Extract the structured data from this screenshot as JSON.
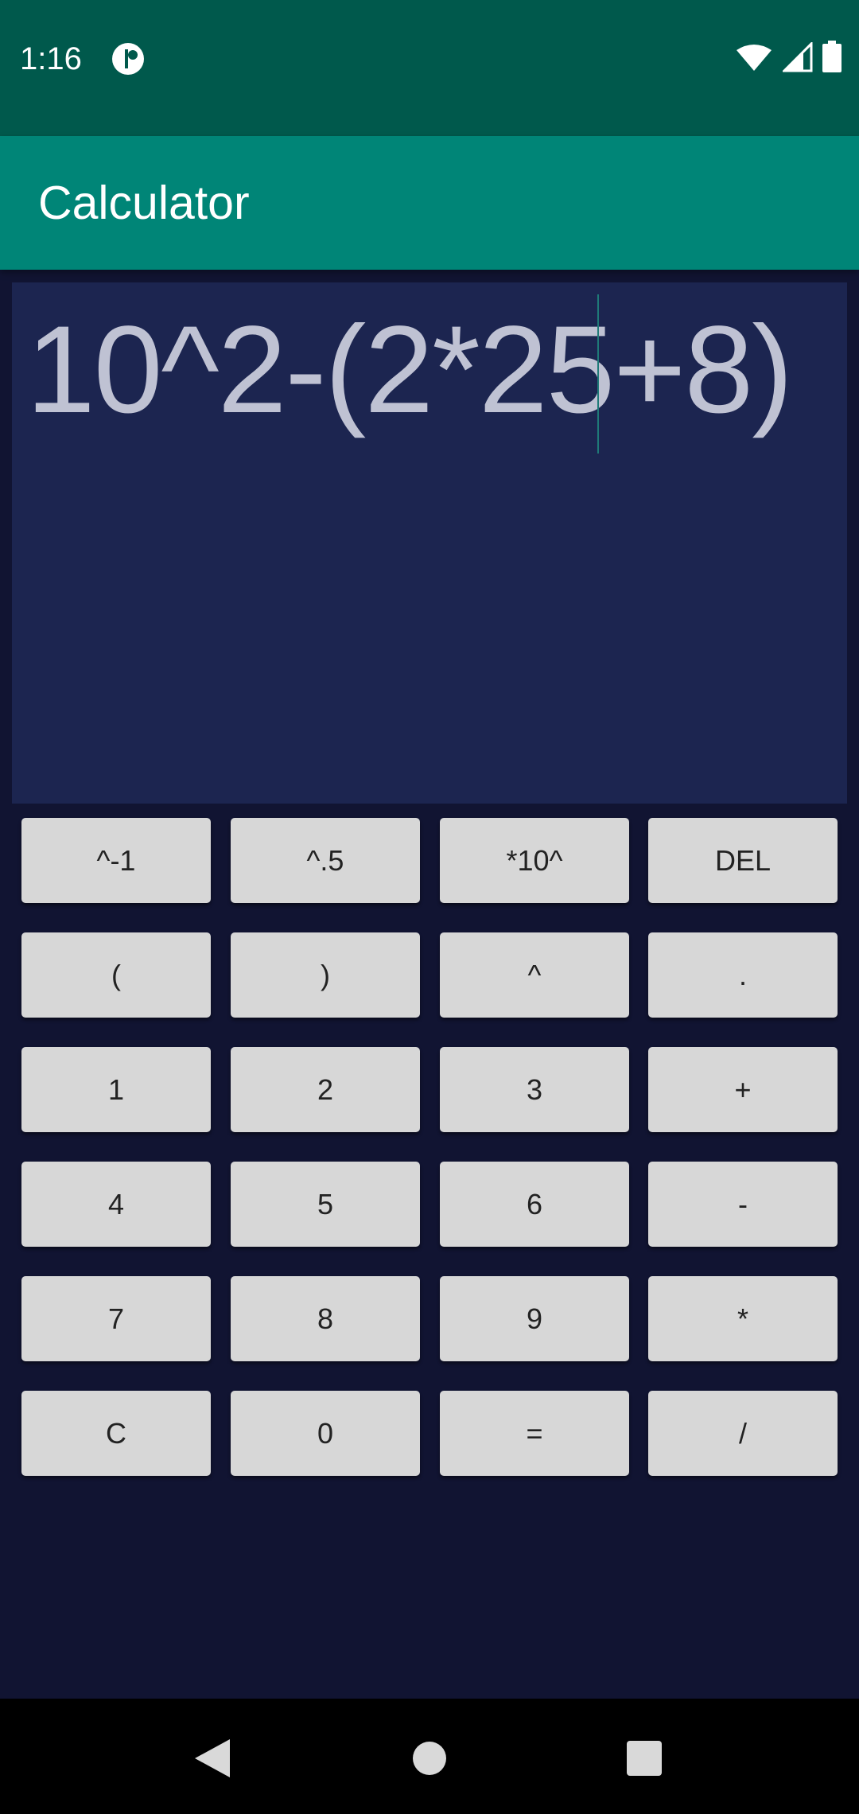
{
  "status_bar": {
    "time": "1:16",
    "left_icon": "media-player-icon",
    "right_icons": [
      "wifi-icon",
      "cellular-signal-icon",
      "battery-icon"
    ]
  },
  "app_bar": {
    "title": "Calculator"
  },
  "display": {
    "expression": "10^2-(2*25+8)"
  },
  "keypad": {
    "rows": [
      [
        "^-1",
        "^.5",
        "*10^",
        "DEL"
      ],
      [
        "(",
        ")",
        "^",
        "."
      ],
      [
        "1",
        "2",
        "3",
        "+"
      ],
      [
        "4",
        "5",
        "6",
        "-"
      ],
      [
        "7",
        "8",
        "9",
        "*"
      ],
      [
        "C",
        "0",
        "=",
        "/"
      ]
    ]
  },
  "nav_bar": {
    "buttons": [
      "back-icon",
      "home-icon",
      "recents-icon"
    ]
  },
  "colors": {
    "status_bar": "#00594c",
    "app_bar": "#008577",
    "display_bg": "#1c2550",
    "page_bg": "#111432",
    "key_bg": "#d7d7d7",
    "display_text": "#bfc2d3"
  }
}
